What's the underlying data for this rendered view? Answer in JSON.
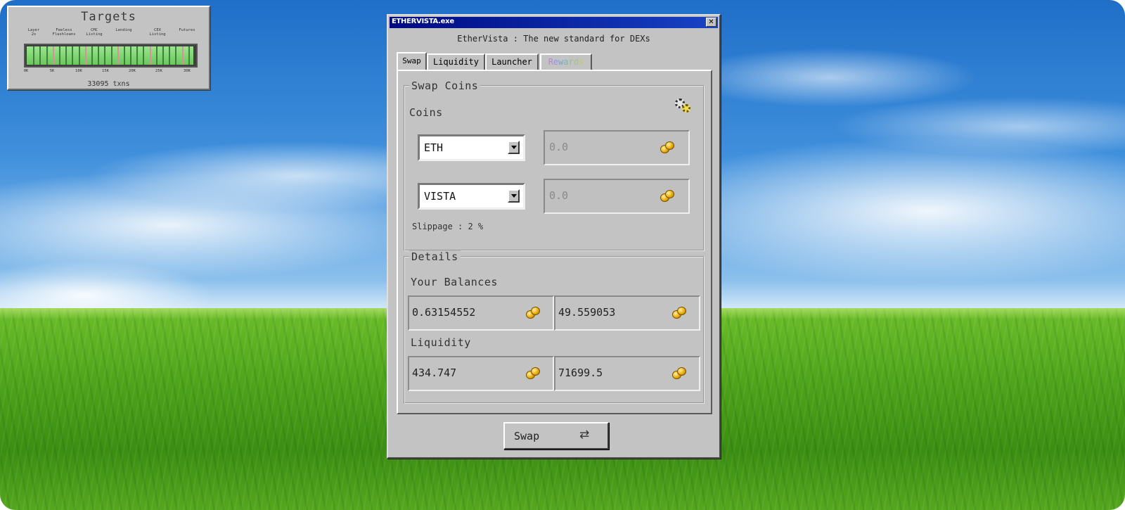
{
  "targets_widget": {
    "title": "Targets",
    "milestones": [
      "Layer\n2s",
      "Feeless\nFlashloans",
      "CMC\nListing",
      "Lending",
      "CEX\nListing",
      "Futures"
    ],
    "ticks": [
      "0K",
      "5K",
      "10K",
      "15K",
      "20K",
      "25K",
      "30K"
    ],
    "progress_fraction": 0.99,
    "txns": "33095 txns"
  },
  "window": {
    "title": "ETHERVISTA.exe",
    "close_label": "✕",
    "subtitle": "EtherVista : The new standard for DEXs",
    "tabs": [
      {
        "label": "Swap",
        "active": true
      },
      {
        "label": "Liquidity",
        "active": false
      },
      {
        "label": "Launcher",
        "active": false
      },
      {
        "label": "Rewards",
        "active": false
      }
    ]
  },
  "swap_panel": {
    "legend": "Swap Coins",
    "coins_label": "Coins",
    "settings_icon": "gear-icon",
    "from": {
      "token": "ETH",
      "amount_placeholder": "0.0"
    },
    "to": {
      "token": "VISTA",
      "amount_placeholder": "0.0"
    },
    "slippage": "Slippage : 2 %"
  },
  "details_panel": {
    "legend": "Details",
    "balances_label": "Your Balances",
    "balances": [
      "0.63154552",
      "49.559053"
    ],
    "liquidity_label": "Liquidity",
    "liquidity": [
      "434.747",
      "71699.5"
    ]
  },
  "swap_button": {
    "label": "Swap",
    "icon": "swap-arrows-icon"
  }
}
